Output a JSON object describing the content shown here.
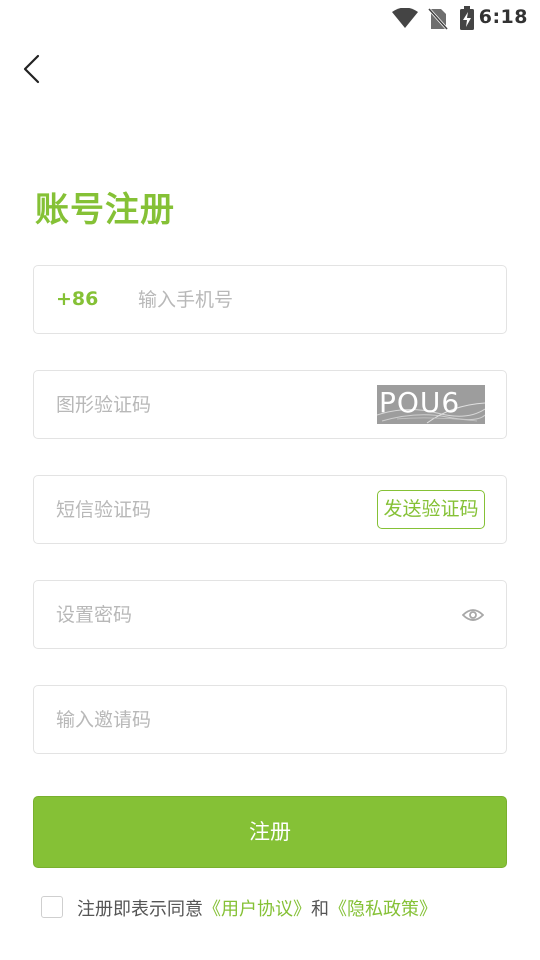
{
  "status_bar": {
    "time": "6:18",
    "icons": [
      "wifi-icon",
      "no-sim-icon",
      "battery-charging-icon"
    ]
  },
  "header": {
    "back_icon": "chevron-left-icon"
  },
  "title": "账号注册",
  "form": {
    "phone": {
      "country_code": "+86",
      "placeholder": "输入手机号",
      "value": ""
    },
    "captcha": {
      "placeholder": "图形验证码",
      "value": "",
      "image_text": "POU6"
    },
    "sms": {
      "placeholder": "短信验证码",
      "value": "",
      "send_label": "发送验证码"
    },
    "password": {
      "placeholder": "设置密码",
      "value": "",
      "toggle_icon": "eye-icon"
    },
    "invite": {
      "placeholder": "输入邀请码",
      "value": ""
    }
  },
  "register_label": "注册",
  "agreement": {
    "checked": false,
    "prefix": "注册即表示同意",
    "user_agreement": "《用户协议》",
    "and": "和",
    "privacy_policy": "《隐私政策》"
  },
  "colors": {
    "accent": "#85c136",
    "border": "#e3e3e3",
    "placeholder": "#b8b8b8",
    "captcha_bg": "#9d9d9d"
  }
}
